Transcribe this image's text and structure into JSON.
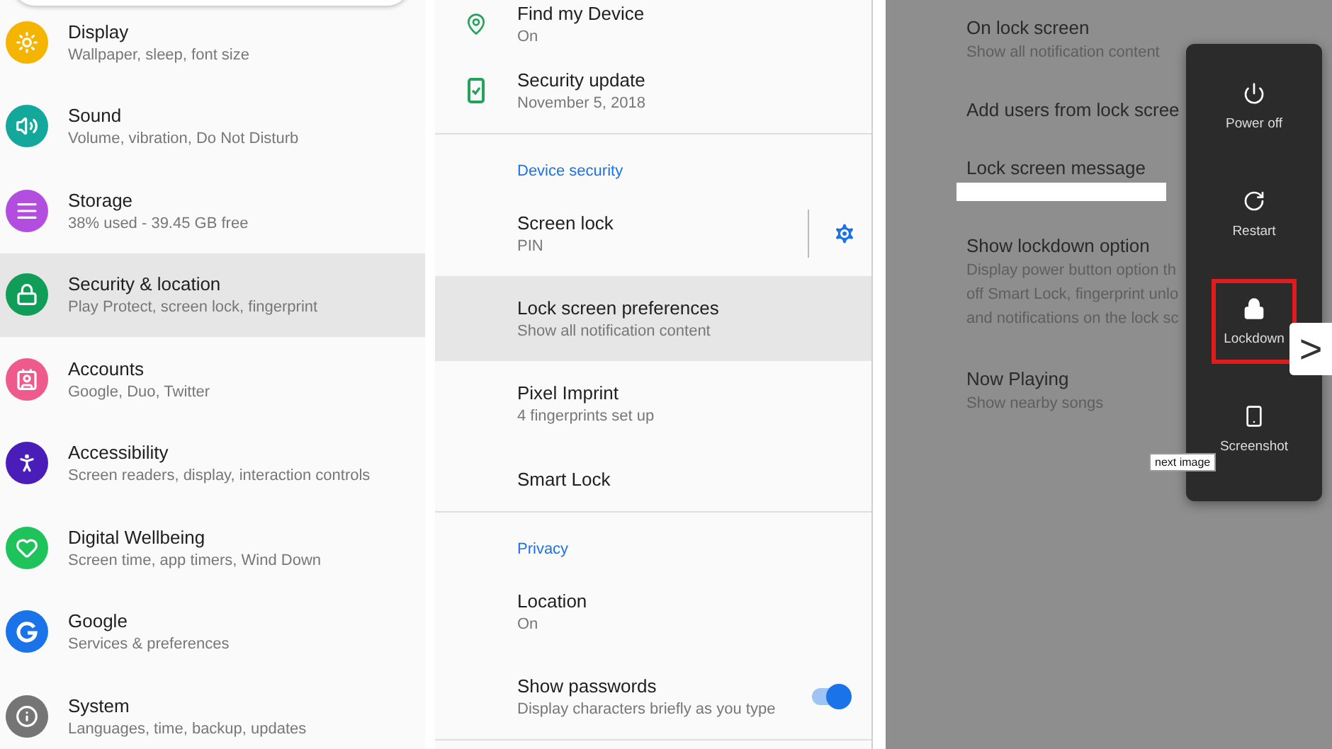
{
  "settings_list": {
    "items": [
      {
        "title": "Display",
        "subtitle": "Wallpaper, sleep, font size",
        "color": "#f4b400",
        "selected": false
      },
      {
        "title": "Sound",
        "subtitle": "Volume, vibration, Do Not Disturb",
        "color": "#14a89c",
        "selected": false
      },
      {
        "title": "Storage",
        "subtitle": "38% used - 39.45 GB free",
        "color": "#b24ddf",
        "selected": false
      },
      {
        "title": "Security & location",
        "subtitle": "Play Protect, screen lock, fingerprint",
        "color": "#0f9d58",
        "selected": true
      },
      {
        "title": "Accounts",
        "subtitle": "Google, Duo, Twitter",
        "color": "#ee5a8c",
        "selected": false
      },
      {
        "title": "Accessibility",
        "subtitle": "Screen readers, display, interaction controls",
        "color": "#4b1db8",
        "selected": false
      },
      {
        "title": "Digital Wellbeing",
        "subtitle": "Screen time, app timers, Wind Down",
        "color": "#1ec35b",
        "selected": false
      },
      {
        "title": "Google",
        "subtitle": "Services & preferences",
        "color": "#1a73e8",
        "selected": false
      },
      {
        "title": "System",
        "subtitle": "Languages, time, backup, updates",
        "color": "#757575",
        "selected": false
      }
    ]
  },
  "security_list": {
    "items": [
      {
        "kind": "item",
        "title": "Find my Device",
        "subtitle": "On",
        "icon": true,
        "selected": false
      },
      {
        "kind": "item",
        "title": "Security update",
        "subtitle": "November 5, 2018",
        "icon": true,
        "selected": false
      },
      {
        "kind": "divider"
      },
      {
        "kind": "header",
        "title": "Device security"
      },
      {
        "kind": "gear",
        "title": "Screen lock",
        "subtitle": "PIN",
        "selected": false
      },
      {
        "kind": "item",
        "title": "Lock screen preferences",
        "subtitle": "Show all notification content",
        "selected": true
      },
      {
        "kind": "item",
        "title": "Pixel Imprint",
        "subtitle": "4 fingerprints set up",
        "selected": false
      },
      {
        "kind": "item",
        "title": "Smart Lock",
        "selected": false
      },
      {
        "kind": "divider"
      },
      {
        "kind": "header",
        "title": "Privacy"
      },
      {
        "kind": "item",
        "title": "Location",
        "subtitle": "On",
        "selected": false
      },
      {
        "kind": "toggle",
        "title": "Show passwords",
        "subtitle": "Display characters briefly as you type",
        "on": true,
        "selected": false
      },
      {
        "kind": "divider"
      }
    ]
  },
  "lock_screen_list": {
    "items": [
      {
        "kind": "item",
        "title": "On lock screen",
        "lines": [
          "Show all notification content"
        ]
      },
      {
        "kind": "item",
        "title": "Add users from lock scree"
      },
      {
        "kind": "redacted",
        "title": "Lock screen message"
      },
      {
        "kind": "item",
        "title": "Show lockdown option",
        "lines": [
          "Display power button option th",
          "off Smart Lock, fingerprint unlo",
          "and notifications on the lock sc"
        ]
      },
      {
        "kind": "item",
        "title": "Now Playing",
        "lines": [
          "Show nearby songs"
        ]
      }
    ]
  },
  "power_menu": {
    "items": [
      {
        "label": "Power off",
        "selected": false
      },
      {
        "label": "Restart",
        "selected": false
      },
      {
        "label": "Lockdown",
        "selected": true
      },
      {
        "label": "Screenshot",
        "selected": false
      }
    ]
  },
  "next_button": {
    "symbol": ">",
    "tooltip": "next image"
  }
}
